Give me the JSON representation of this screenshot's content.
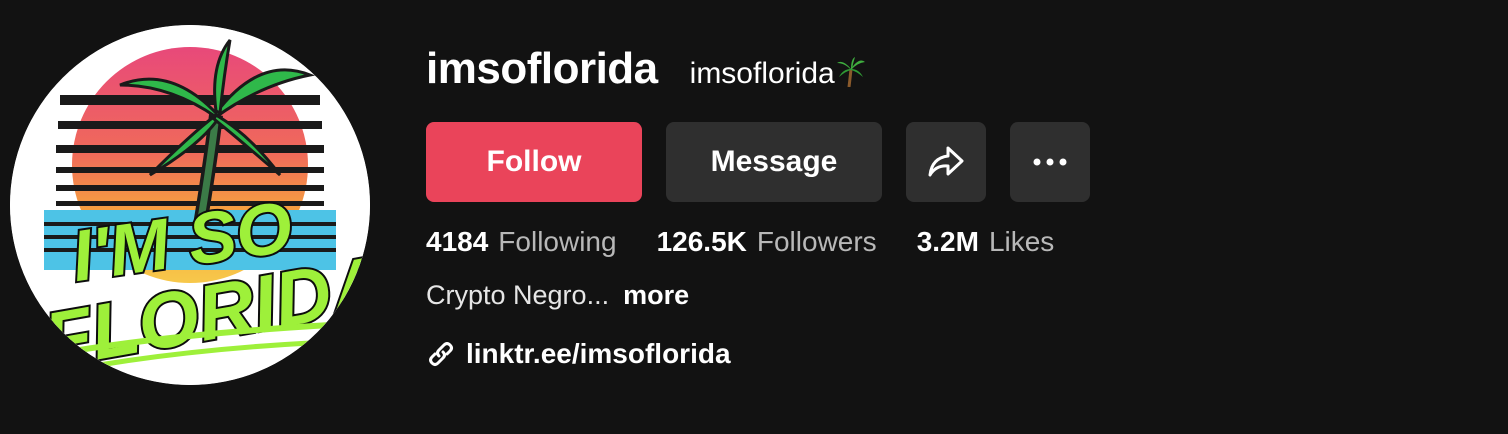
{
  "profile": {
    "username": "imsoflorida",
    "nickname": "imsoflorida",
    "nickname_emoji": "palm-tree-icon",
    "avatar": "im-so-florida-logo"
  },
  "buttons": {
    "follow": "Follow",
    "message": "Message",
    "share_icon": "share-icon",
    "more_icon": "more-options-icon"
  },
  "stats": [
    {
      "value": "4184",
      "label": "Following"
    },
    {
      "value": "126.5K",
      "label": "Followers"
    },
    {
      "value": "3.2M",
      "label": "Likes"
    }
  ],
  "bio": {
    "text": "Crypto Negro...",
    "more": "more"
  },
  "link": {
    "icon": "link-icon",
    "text": "linktr.ee/imsoflorida"
  },
  "colors": {
    "background": "#121212",
    "follow_button": "#ea445a",
    "secondary_button": "#2f2f2f"
  }
}
